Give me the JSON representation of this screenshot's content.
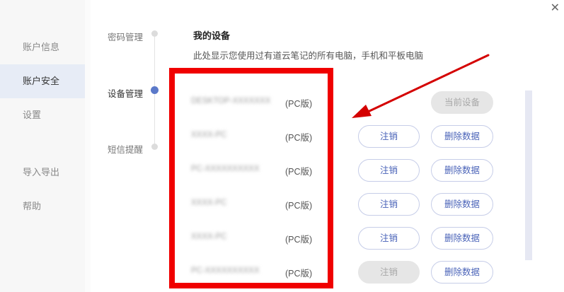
{
  "window": {
    "close_glyph": "✕"
  },
  "left_nav": {
    "items": [
      {
        "label": "账户信息"
      },
      {
        "label": "账户安全"
      },
      {
        "label": "设置"
      },
      {
        "label": "导入导出"
      },
      {
        "label": "帮助"
      }
    ],
    "active": "账户安全"
  },
  "steps": [
    {
      "label": "密码管理"
    },
    {
      "label": "设备管理"
    },
    {
      "label": "短信提醒"
    }
  ],
  "active_step": "设备管理",
  "section": {
    "title": "我的设备",
    "description": "此处显示您使用过有道云笔记的所有电脑，手机和平板电脑"
  },
  "devices": [
    {
      "name": "DESKTOP-XXXXXXX",
      "type": "(PC版)",
      "current_label": "当前设备"
    },
    {
      "name": "XXXX-PC",
      "type": "(PC版)",
      "cancel_label": "注销",
      "delete_label": "删除数据"
    },
    {
      "name": "PC-XXXXXXXXXX",
      "type": "(PC版)",
      "cancel_label": "注销",
      "delete_label": "删除数据"
    },
    {
      "name": "XXXX-PC",
      "type": "(PC版)",
      "cancel_label": "注销",
      "delete_label": "删除数据"
    },
    {
      "name": "XXXX-PC",
      "type": "(PC版)",
      "cancel_label": "注销",
      "delete_label": "删除数据"
    },
    {
      "name": "PC-XXXXXXXXXX",
      "type": "(PC版)",
      "cancel_label": "注销",
      "delete_label": "删除数据",
      "cancel_disabled": true
    }
  ],
  "colors": {
    "accent": "#5b79c9",
    "annotation_red": "#f00000",
    "button_text": "#4a63b8",
    "disabled_bg": "#e6e6e6"
  },
  "icons": [
    "close-icon",
    "step-dot-icon"
  ]
}
